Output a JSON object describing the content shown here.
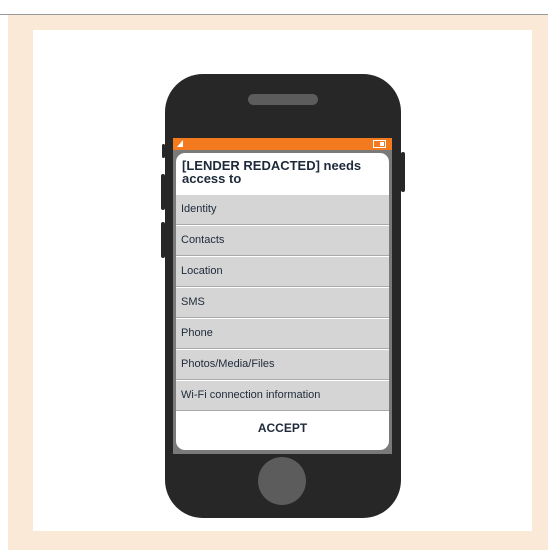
{
  "dialog": {
    "title": "[LENDER REDACTED] needs access to",
    "permissions": [
      "Identity",
      "Contacts",
      "Location",
      "SMS",
      "Phone",
      "Photos/Media/Files",
      "Wi-Fi connection information"
    ],
    "accept_label": "ACCEPT"
  },
  "colors": {
    "status_bar": "#f47a1f",
    "background_tint": "#fbe9d8",
    "phone_body": "#272727"
  }
}
